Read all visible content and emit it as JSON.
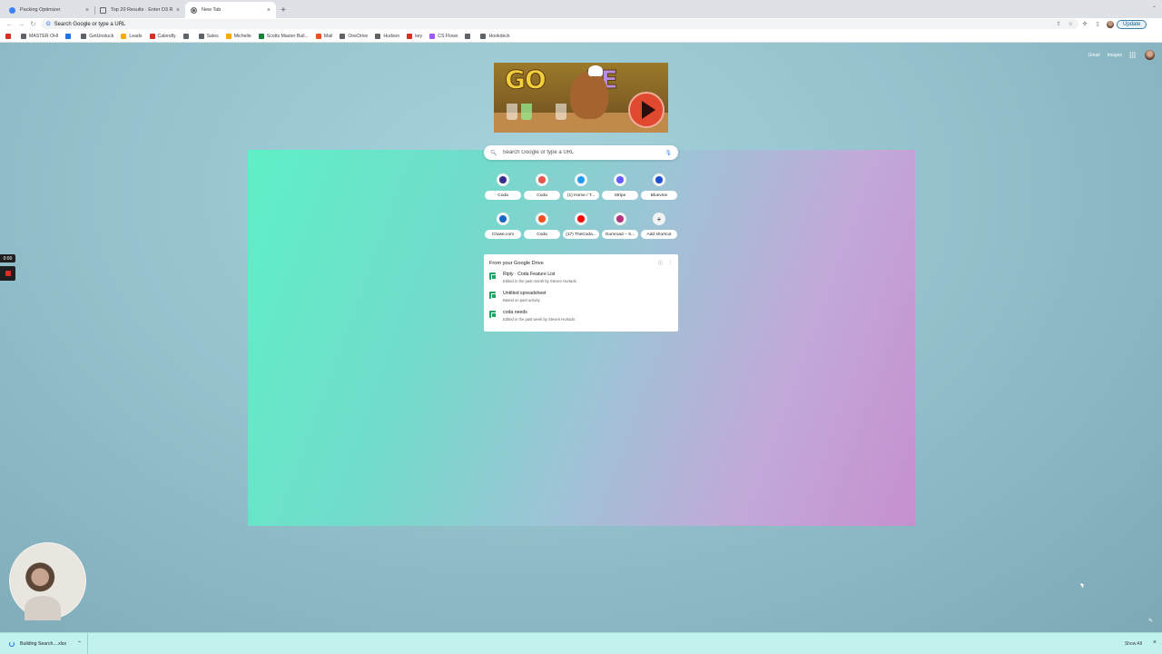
{
  "tabs": [
    {
      "title": "Packing Optimizer",
      "icon": "packing-icon",
      "color": "#3b82f6",
      "active": false
    },
    {
      "title": "Top 20 Results · Enter D3 Rec...",
      "icon": "wrench-icon",
      "color": "#5f6368",
      "active": false
    },
    {
      "title": "New Tab",
      "icon": "chrome-icon",
      "color": "#5f6368",
      "active": true
    }
  ],
  "toolbar": {
    "omnibox_text": "Search Google or type a URL",
    "update_label": "Update"
  },
  "bookmarks": [
    {
      "label": "",
      "icon": "red-square-icon",
      "color": "#d93025"
    },
    {
      "label": "MASTER OHI",
      "icon": "doc-icon",
      "color": "#5f6368"
    },
    {
      "label": "",
      "icon": "pen-icon",
      "color": "#1a73e8"
    },
    {
      "label": "GetUnstuck",
      "icon": "folder-icon",
      "color": "#5f6368"
    },
    {
      "label": "Leads",
      "icon": "star-icon",
      "color": "#f9ab00"
    },
    {
      "label": "Calendly",
      "icon": "calendly-icon",
      "color": "#d93025"
    },
    {
      "label": "",
      "icon": "link-icon",
      "color": "#5f6368"
    },
    {
      "label": "Sales",
      "icon": "folder-icon",
      "color": "#5f6368"
    },
    {
      "label": "Michelle",
      "icon": "smiley-icon",
      "color": "#f9ab00"
    },
    {
      "label": "Scotts Master Buil...",
      "icon": "gear-icon",
      "color": "#188038"
    },
    {
      "label": "Mail",
      "icon": "microsoft-icon",
      "color": "#f25022"
    },
    {
      "label": "OneDrive",
      "icon": "folder-icon",
      "color": "#5f6368"
    },
    {
      "label": "Hudson",
      "icon": "folder-icon",
      "color": "#5f6368"
    },
    {
      "label": "key",
      "icon": "key-icon",
      "color": "#d93025"
    },
    {
      "label": "CS Flows",
      "icon": "figma-icon",
      "color": "#a259ff"
    },
    {
      "label": "",
      "icon": "pencil-icon",
      "color": "#5f6368"
    },
    {
      "label": "Hookdeck",
      "icon": "hook-icon",
      "color": "#5f6368"
    }
  ],
  "header_links": {
    "gmail": "Gmail",
    "images": "Images"
  },
  "search": {
    "placeholder": "Search Google or type a URL"
  },
  "shortcuts": [
    {
      "label": "Coda",
      "icon": "coda-icon",
      "color": "#3a2e8c"
    },
    {
      "label": "Coda",
      "icon": "coda-red-icon",
      "color": "#e2574c"
    },
    {
      "label": "(1) Home / T...",
      "icon": "twitter-icon",
      "color": "#1d9bf0"
    },
    {
      "label": "Stripe",
      "icon": "stripe-icon",
      "color": "#635bff"
    },
    {
      "label": "Bluevine",
      "icon": "bluevine-icon",
      "color": "#1f4fd1"
    },
    {
      "label": "Chase.com",
      "icon": "chase-icon",
      "color": "#1a67c1"
    },
    {
      "label": "Coda",
      "icon": "figma-icon",
      "color": "#f24e1e"
    },
    {
      "label": "(17) TheCoda...",
      "icon": "youtube-icon",
      "color": "#ff0000"
    },
    {
      "label": "Gumroad – S...",
      "icon": "gumroad-icon",
      "color": "#b3317d"
    },
    {
      "label": "Add shortcut",
      "icon": "plus-icon",
      "color": "#5f6368"
    }
  ],
  "drive": {
    "title": "From your Google Drive",
    "items": [
      {
        "name": "Riply · Coda Feature List",
        "sub": "Edited in the past month by Steven Hurtado"
      },
      {
        "name": "Untitled spreadsheet",
        "sub": "Based on past activity"
      },
      {
        "name": "coda needs",
        "sub": "Edited in the past week by Steven Hurtado"
      }
    ]
  },
  "recording": {
    "time": "0:00"
  },
  "downloads": {
    "file": "Building Search....xlsx",
    "show_all": "Show All"
  }
}
